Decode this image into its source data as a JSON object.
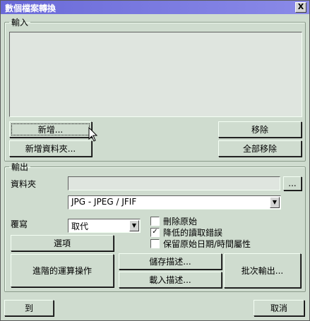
{
  "window": {
    "title": "數個檔案轉換",
    "close_label": "X"
  },
  "input_group": {
    "legend": "輸入",
    "add_label": "新增...",
    "add_folder_label": "新增資料夾...",
    "remove_label": "移除",
    "remove_all_label": "全部移除"
  },
  "output_group": {
    "legend": "輸出",
    "folder_label": "資料夾",
    "folder_value": "",
    "browse_label": "...",
    "format_value": "JPG - JPEG / JFIF",
    "overwrite_label": "覆寫",
    "overwrite_value": "取代",
    "checkboxes": [
      {
        "label": "刪除原始",
        "checked": false,
        "mark": ""
      },
      {
        "label": "降低的讀取錯誤",
        "checked": true,
        "mark": "✓"
      },
      {
        "label": "保留原始日期/時間屬性",
        "checked": false,
        "mark": ""
      }
    ],
    "options_label": "選項",
    "advanced_label": "進階的運算操作",
    "save_desc_label": "儲存描述...",
    "load_desc_label": "載入描述...",
    "batch_label": "批次輸出..."
  },
  "footer": {
    "go_label": "到",
    "cancel_label": "取消"
  }
}
